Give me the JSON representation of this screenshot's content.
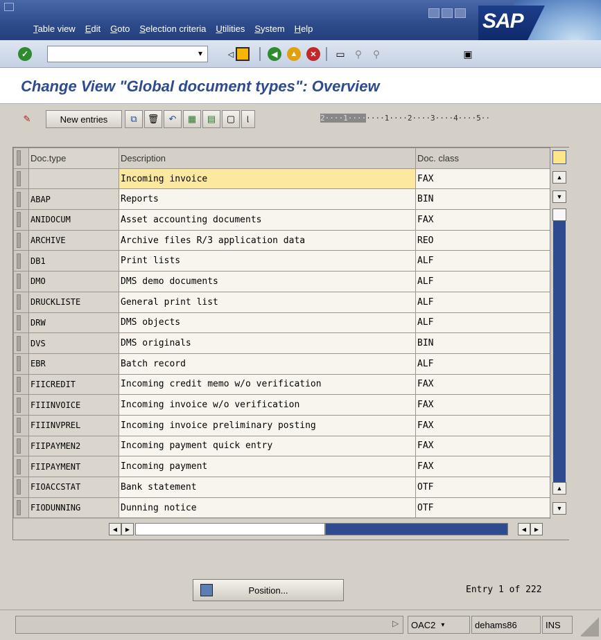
{
  "menu": [
    "Table view",
    "Edit",
    "Goto",
    "Selection criteria",
    "Utilities",
    "System",
    "Help"
  ],
  "logo": "SAP",
  "title": "Change View \"Global document types\": Overview",
  "toolbar": {
    "new_entries": "New entries"
  },
  "ruler": {
    "dark": "2····1····",
    "light": "····1····2····3····4····5··"
  },
  "table": {
    "headers": {
      "doc_type": "Doc.type",
      "description": "Description",
      "doc_class": "Doc. class"
    },
    "rows": [
      {
        "doc_type": "",
        "description": "Incoming invoice",
        "doc_class": "FAX"
      },
      {
        "doc_type": "ABAP",
        "description": "Reports",
        "doc_class": "BIN"
      },
      {
        "doc_type": "ANIDOCUM",
        "description": "Asset accounting documents",
        "doc_class": "FAX"
      },
      {
        "doc_type": "ARCHIVE",
        "description": "Archive files R/3 application data",
        "doc_class": "REO"
      },
      {
        "doc_type": "DB1",
        "description": "Print lists",
        "doc_class": "ALF"
      },
      {
        "doc_type": "DMO",
        "description": "DMS demo documents",
        "doc_class": "ALF"
      },
      {
        "doc_type": "DRUCKLISTE",
        "description": "General print list",
        "doc_class": "ALF"
      },
      {
        "doc_type": "DRW",
        "description": "DMS objects",
        "doc_class": "ALF"
      },
      {
        "doc_type": "DVS",
        "description": "DMS originals",
        "doc_class": "BIN"
      },
      {
        "doc_type": "EBR",
        "description": "Batch record",
        "doc_class": "ALF"
      },
      {
        "doc_type": "FIICREDIT",
        "description": "Incoming credit memo w/o verification",
        "doc_class": "FAX"
      },
      {
        "doc_type": "FIIINVOICE",
        "description": "Incoming invoice w/o verification",
        "doc_class": "FAX"
      },
      {
        "doc_type": "FIIINVPREL",
        "description": "Incoming invoice preliminary posting",
        "doc_class": "FAX"
      },
      {
        "doc_type": "FIIPAYMEN2",
        "description": "Incoming payment quick entry",
        "doc_class": "FAX"
      },
      {
        "doc_type": "FIIPAYMENT",
        "description": "Incoming payment",
        "doc_class": "FAX"
      },
      {
        "doc_type": "FIOACCSTAT",
        "description": "Bank statement",
        "doc_class": "OTF"
      },
      {
        "doc_type": "FIODUNNING",
        "description": "Dunning notice",
        "doc_class": "OTF"
      }
    ]
  },
  "position_button": "Position...",
  "entry_info": "Entry 1 of 222",
  "status": {
    "transaction": "OAC2",
    "server": "dehams86",
    "mode": "INS"
  }
}
